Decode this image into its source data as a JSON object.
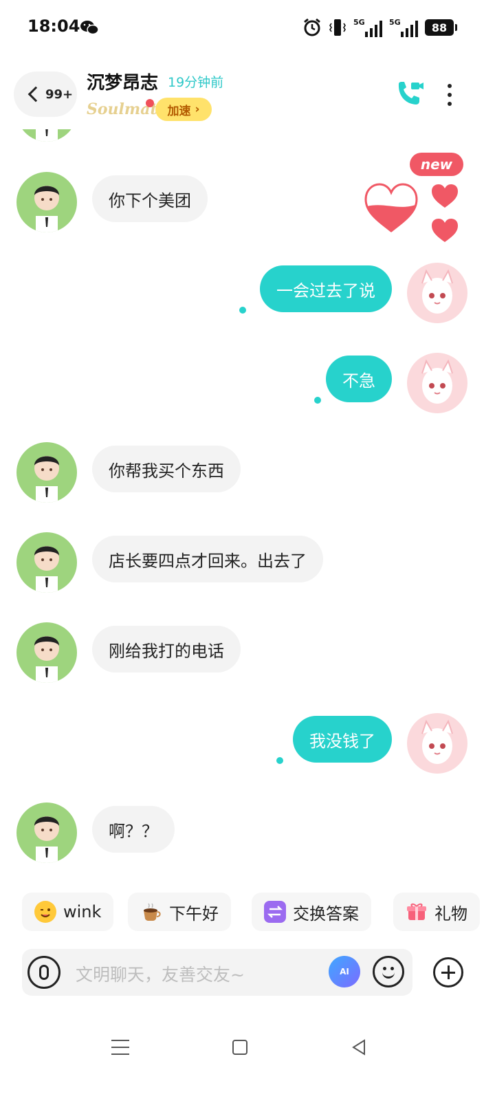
{
  "status_bar": {
    "time": "18:04",
    "battery": "88",
    "signal1": "5G",
    "signal2": "5G"
  },
  "header": {
    "back_count": "99+",
    "contact_name": "沉梦昂志",
    "last_seen": "19分钟前",
    "soulmate_label": "Soulmate",
    "speed_label": "加速",
    "speed_chevron": "›"
  },
  "reaction": {
    "new_label": "new"
  },
  "messages": [
    {
      "side": "in",
      "text": "你下个美团"
    },
    {
      "side": "out",
      "text": "一会过去了说"
    },
    {
      "side": "out",
      "text": "不急"
    },
    {
      "side": "in",
      "text": "你帮我买个东西"
    },
    {
      "side": "in",
      "text": "店长要四点才回来。出去了"
    },
    {
      "side": "in",
      "text": "刚给我打的电话"
    },
    {
      "side": "out",
      "text": "我没钱了"
    },
    {
      "side": "in",
      "text": "啊？？"
    }
  ],
  "quick_chips": [
    {
      "label": "wink",
      "icon": "wink-emoji-icon",
      "color": "#ffc93a"
    },
    {
      "label": "下午好",
      "icon": "coffee-cup-icon",
      "color": "#c98a4a"
    },
    {
      "label": "交换答案",
      "icon": "exchange-icon",
      "color": "#9b6bf0"
    },
    {
      "label": "礼物",
      "icon": "gift-icon",
      "color": "#f7607a"
    }
  ],
  "input": {
    "placeholder": "文明聊天，友善交友~",
    "ai_label": "AI"
  },
  "colors": {
    "accent": "#27d2cc",
    "speed_bg": "#ffe26b",
    "heart": "#f05865"
  }
}
